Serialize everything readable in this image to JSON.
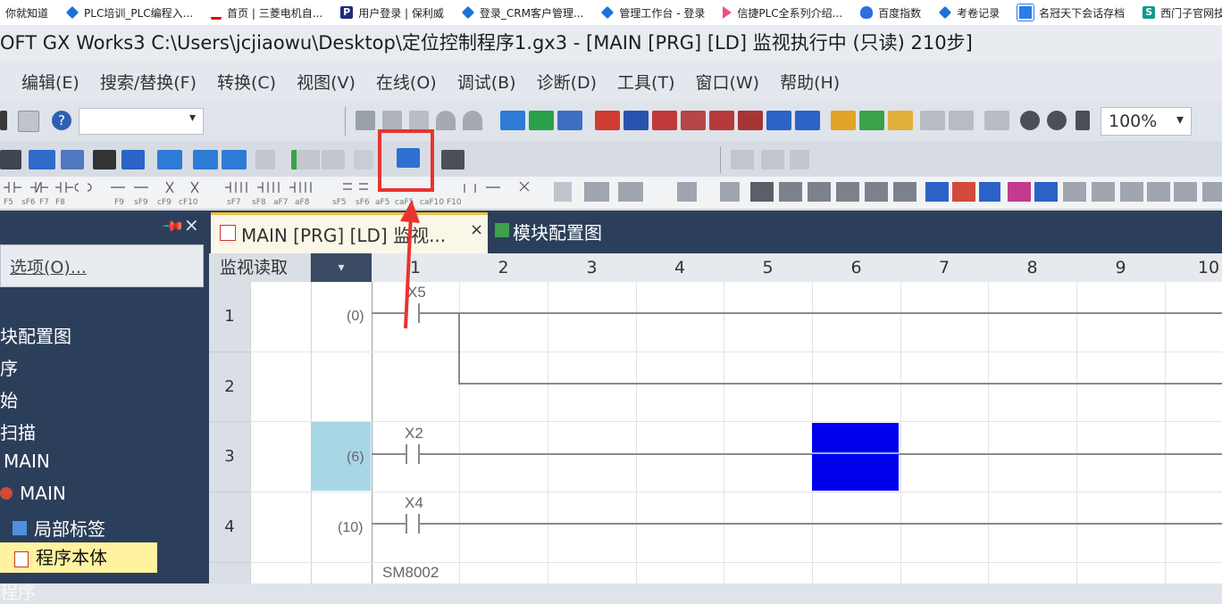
{
  "bookmarks": [
    {
      "label": "你就知道",
      "icon": "none"
    },
    {
      "label": "PLC培训_PLC编程入...",
      "icon": "diamond-icon"
    },
    {
      "label": "首页 | 三菱电机自...",
      "icon": "mitsubishi-icon"
    },
    {
      "label": "用户登录 | 保利威",
      "icon": "polyv-icon"
    },
    {
      "label": "登录_CRM客户管理...",
      "icon": "diamond-icon"
    },
    {
      "label": "管理工作台 - 登录",
      "icon": "diamond-icon"
    },
    {
      "label": "信捷PLC全系列介绍...",
      "icon": "video-icon"
    },
    {
      "label": "百度指数",
      "icon": "baidu-icon"
    },
    {
      "label": "考卷记录",
      "icon": "diamond-icon"
    },
    {
      "label": "名冠天下会话存档",
      "icon": "chat-icon"
    },
    {
      "label": "西门子官网技术支",
      "icon": "s-icon"
    }
  ],
  "window": {
    "title": "OFT GX Works3 C:\\Users\\jcjiaowu\\Desktop\\定位控制程序1.gx3 - [MAIN [PRG] [LD] 监视执行中 (只读) 210步]"
  },
  "menu": [
    "编辑(E)",
    "搜索/替换(F)",
    "转换(C)",
    "视图(V)",
    "在线(O)",
    "调试(B)",
    "诊断(D)",
    "工具(T)",
    "窗口(W)",
    "帮助(H)"
  ],
  "toolbar": {
    "zoom": "100%"
  },
  "fkeys": [
    "F5",
    "sF6",
    "F7",
    "F8",
    "F9",
    "sF9",
    "cF9",
    "cF10",
    "sF7",
    "sF8",
    "aF7",
    "aF8",
    "sF5",
    "sF6",
    "aF5",
    "caF5",
    "caF10",
    "F10"
  ],
  "left_panel": {
    "pin": "📌",
    "close": "×",
    "options_label": "选项(O)...",
    "tree": [
      "块配置图",
      "序",
      "始",
      "扫描",
      "MAIN",
      "MAIN",
      "局部标签",
      "程序本体",
      "程序"
    ]
  },
  "tabs": [
    {
      "label": "MAIN [PRG] [LD] 监视...",
      "close": "×"
    },
    {
      "label": "模块配置图"
    }
  ],
  "grid": {
    "corner_label": "监视读取",
    "corner_dropdown": "▾",
    "columns": [
      "1",
      "2",
      "3",
      "4",
      "5",
      "6",
      "7",
      "8",
      "9",
      "10"
    ],
    "rows": [
      {
        "num": "1",
        "step": "(0)",
        "contact": "X5"
      },
      {
        "num": "2",
        "step": "",
        "contact": ""
      },
      {
        "num": "3",
        "step": "(6)",
        "contact": "X2"
      },
      {
        "num": "4",
        "step": "(10)",
        "contact": "X4"
      }
    ],
    "next_contact": "SM8002"
  },
  "colors": {
    "highlight": "#e8342f",
    "selection": "#0000ee",
    "step_selected": "#a9d6e5",
    "tree_selected": "#fff3a0"
  }
}
